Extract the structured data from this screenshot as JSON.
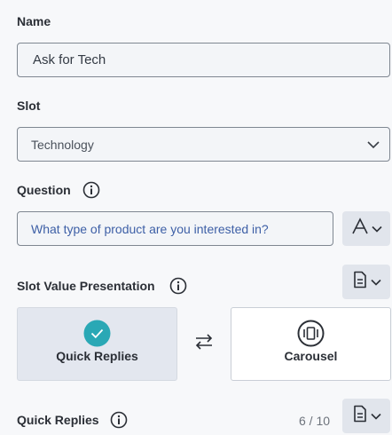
{
  "name": {
    "label": "Name",
    "value": "Ask for Tech"
  },
  "slot": {
    "label": "Slot",
    "selected": "Technology"
  },
  "question": {
    "label": "Question",
    "value": "What type of product are you interested in?"
  },
  "slot_value_presentation": {
    "label": "Slot Value Presentation",
    "options": [
      {
        "label": "Quick Replies",
        "selected": true
      },
      {
        "label": "Carousel",
        "selected": false
      }
    ]
  },
  "quick_replies": {
    "label": "Quick Replies",
    "counter": "6 / 10"
  },
  "colors": {
    "accent": "#2aa8b5",
    "field_bg": "#f3f5f8",
    "button_bg": "#e1e5ec",
    "question_text": "#3d5fa6"
  }
}
